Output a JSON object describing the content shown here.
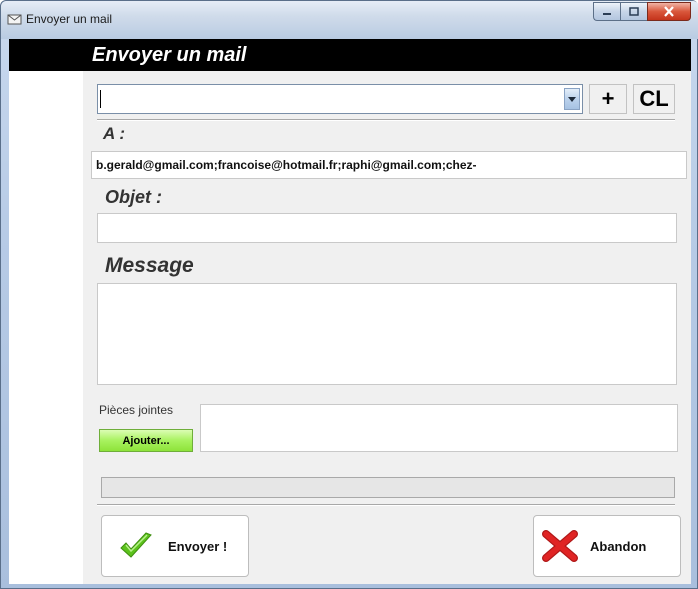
{
  "window": {
    "title": "Envoyer un mail",
    "icon": "mail-icon",
    "controls": [
      "minimize-icon",
      "maximize-icon",
      "close-icon"
    ]
  },
  "header": {
    "title": "Envoyer un mail"
  },
  "recipients": {
    "combo_value": "",
    "add_label": "+",
    "cl_label": "CL"
  },
  "to": {
    "label": "A :",
    "value": "b.gerald@gmail.com;francoise@hotmail.fr;raphi@gmail.com;chez-"
  },
  "subject": {
    "label": "Objet :",
    "value": ""
  },
  "message": {
    "label": "Message",
    "value": ""
  },
  "attachments": {
    "label": "Pièces jointes",
    "add_label": "Ajouter...",
    "value": ""
  },
  "progress": {
    "value": 0
  },
  "actions": {
    "send_label": "Envoyer !",
    "send_icon": "checkmark-icon",
    "cancel_label": "Abandon",
    "cancel_icon": "red-x-icon"
  },
  "colors": {
    "header_bg": "#000000",
    "header_text": "#ffffff",
    "panel_bg": "#f0f0f0",
    "attach_button": "#a8f25f",
    "send_check": "#5cc21c",
    "cancel_x": "#e02424"
  }
}
